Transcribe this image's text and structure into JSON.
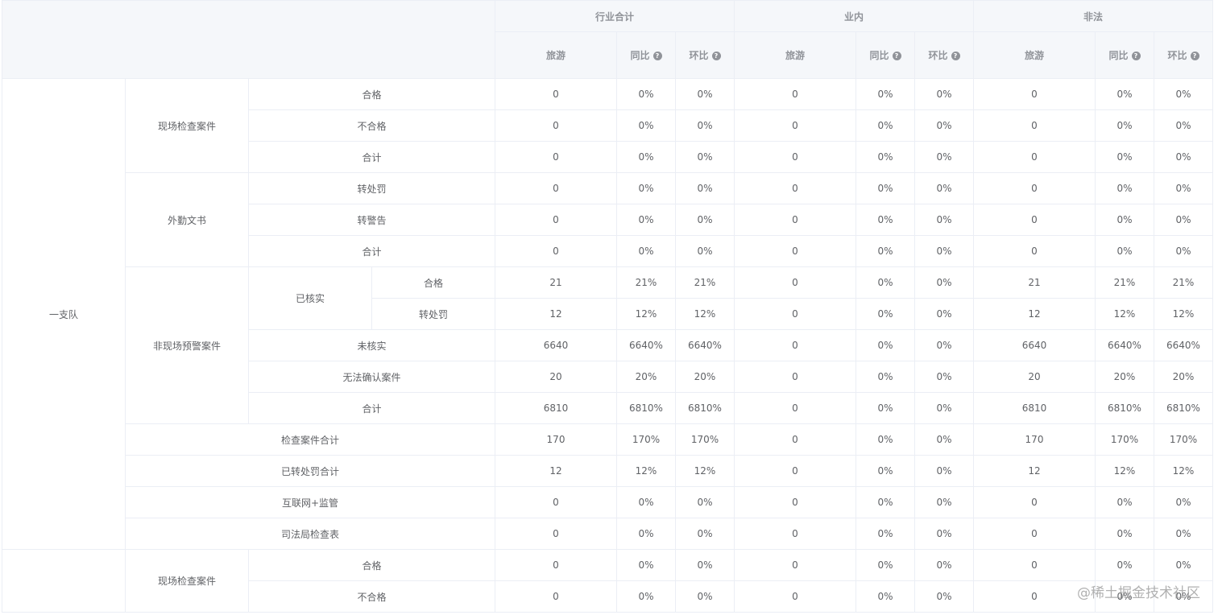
{
  "header": {
    "groups": [
      "行业合计",
      "业内",
      "非法"
    ],
    "sub_cols": [
      "旅游",
      "同比",
      "环比"
    ]
  },
  "units": [
    {
      "name": "一支队",
      "sections": [
        {
          "label": "现场检查案件",
          "rows": [
            {
              "label": "合格",
              "values": [
                "0",
                "0%",
                "0%",
                "0",
                "0%",
                "0%",
                "0",
                "0%",
                "0%"
              ]
            },
            {
              "label": "不合格",
              "values": [
                "0",
                "0%",
                "0%",
                "0",
                "0%",
                "0%",
                "0",
                "0%",
                "0%"
              ]
            },
            {
              "label": "合计",
              "values": [
                "0",
                "0%",
                "0%",
                "0",
                "0%",
                "0%",
                "0",
                "0%",
                "0%"
              ]
            }
          ]
        },
        {
          "label": "外勤文书",
          "rows": [
            {
              "label": "转处罚",
              "values": [
                "0",
                "0%",
                "0%",
                "0",
                "0%",
                "0%",
                "0",
                "0%",
                "0%"
              ]
            },
            {
              "label": "转警告",
              "values": [
                "0",
                "0%",
                "0%",
                "0",
                "0%",
                "0%",
                "0",
                "0%",
                "0%"
              ]
            },
            {
              "label": "合计",
              "values": [
                "0",
                "0%",
                "0%",
                "0",
                "0%",
                "0%",
                "0",
                "0%",
                "0%"
              ]
            }
          ]
        },
        {
          "label": "非现场预警案件",
          "subgroups": [
            {
              "label": "已核实",
              "rows": [
                {
                  "label": "合格",
                  "values": [
                    "21",
                    "21%",
                    "21%",
                    "0",
                    "0%",
                    "0%",
                    "21",
                    "21%",
                    "21%"
                  ]
                },
                {
                  "label": "转处罚",
                  "values": [
                    "12",
                    "12%",
                    "12%",
                    "0",
                    "0%",
                    "0%",
                    "12",
                    "12%",
                    "12%"
                  ]
                }
              ]
            }
          ],
          "rows": [
            {
              "label": "未核实",
              "values": [
                "6640",
                "6640%",
                "6640%",
                "0",
                "0%",
                "0%",
                "6640",
                "6640%",
                "6640%"
              ]
            },
            {
              "label": "无法确认案件",
              "values": [
                "20",
                "20%",
                "20%",
                "0",
                "0%",
                "0%",
                "20",
                "20%",
                "20%"
              ]
            },
            {
              "label": "合计",
              "values": [
                "6810",
                "6810%",
                "6810%",
                "0",
                "0%",
                "0%",
                "6810",
                "6810%",
                "6810%"
              ]
            }
          ]
        }
      ],
      "totals": [
        {
          "label": "检查案件合计",
          "values": [
            "170",
            "170%",
            "170%",
            "0",
            "0%",
            "0%",
            "170",
            "170%",
            "170%"
          ]
        },
        {
          "label": "已转处罚合计",
          "values": [
            "12",
            "12%",
            "12%",
            "0",
            "0%",
            "0%",
            "12",
            "12%",
            "12%"
          ]
        },
        {
          "label": "互联网+监管",
          "values": [
            "0",
            "0%",
            "0%",
            "0",
            "0%",
            "0%",
            "0",
            "0%",
            "0%"
          ]
        },
        {
          "label": "司法局检查表",
          "values": [
            "0",
            "0%",
            "0%",
            "0",
            "0%",
            "0%",
            "0",
            "0%",
            "0%"
          ]
        }
      ]
    },
    {
      "name": "",
      "sections": [
        {
          "label": "现场检查案件",
          "rows": [
            {
              "label": "合格",
              "values": [
                "0",
                "0%",
                "0%",
                "0",
                "0%",
                "0%",
                "0",
                "0%",
                "0%"
              ]
            },
            {
              "label": "不合格",
              "values": [
                "0",
                "0%",
                "0%",
                "0",
                "0%",
                "0%",
                "0",
                "0%",
                "0%"
              ]
            }
          ]
        }
      ]
    }
  ],
  "watermark": "@稀土掘金技术社区",
  "colors": {
    "header_bg": "#f5f7fa",
    "border": "#ebeef5",
    "text": "#606266",
    "header_text": "#909399"
  }
}
